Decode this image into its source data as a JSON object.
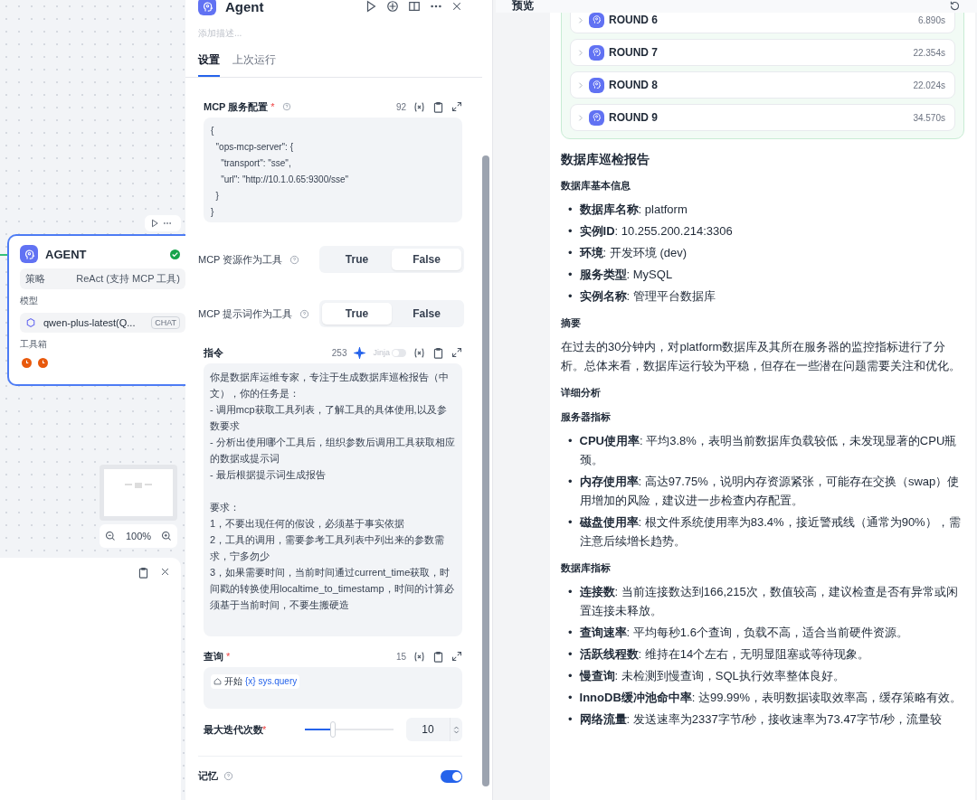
{
  "canvas": {
    "node": {
      "title": "AGENT",
      "strategy_label": "策略",
      "strategy_value": "ReAct (支持 MCP 工具)",
      "model_label": "模型",
      "model_name": "qwen-plus-latest(Q...",
      "model_tag": "CHAT",
      "tools_label": "工具箱",
      "tools": [
        {
          "color": "#e8590c"
        },
        {
          "color": "#e8590c"
        }
      ]
    },
    "zoom": "100%"
  },
  "panel": {
    "title": "Agent",
    "description_placeholder": "添加描述...",
    "tabs": [
      {
        "label": "设置",
        "selected": true
      },
      {
        "label": "上次运行",
        "selected": false
      }
    ],
    "mcp_config": {
      "label": "MCP 服务配置",
      "required_mark": "*",
      "count": "92",
      "value": "{\n  \"ops-mcp-server\": {\n    \"transport\": \"sse\",\n    \"url\": \"http://10.1.0.65:9300/sse\"\n  }\n}"
    },
    "switches": [
      {
        "label": "MCP 资源作为工具",
        "options": [
          {
            "label": "True",
            "selected": false
          },
          {
            "label": "False",
            "selected": true
          }
        ]
      },
      {
        "label": "MCP 提示词作为工具",
        "options": [
          {
            "label": "True",
            "selected": true
          },
          {
            "label": "False",
            "selected": false
          }
        ]
      }
    ],
    "instruction": {
      "label": "指令",
      "count": "253",
      "jinja_label": "Jinja",
      "jinja_on": false,
      "paragraphs": [
        [
          "你是数据库运维专家，专注于生成数据库巡检报告（中文），你的任务是：",
          "- 调用mcp获取工具列表，了解工具的具体使用,以及参数要求",
          "- 分析出使用哪个工具后，组织参数后调用工具获取相应的数据或提示词",
          "- 最后根据提示词生成报告"
        ],
        [
          "要求：",
          "1，不要出现任何的假设，必须基于事实依据",
          "2，工具的调用，需要参考工具列表中列出来的参数需求，宁多勿少",
          "3，如果需要时间，当前时间通过current_time获取，时间戳的转换使用localtime_to_timestamp，时间的计算必须基于当前时间，不要生搬硬造"
        ]
      ]
    },
    "query": {
      "label": "查询",
      "required_mark": "*",
      "count": "15",
      "source": "开始",
      "variable": "{x} sys.query"
    },
    "iterations": {
      "label": "最大迭代次数",
      "required_mark": "*",
      "level": 0.32,
      "value": "10"
    },
    "memory": {
      "label": "记忆",
      "on": true
    }
  },
  "preview": {
    "title": "预览",
    "rounds": [
      {
        "name": "ROUND 6",
        "time": "6.890s"
      },
      {
        "name": "ROUND 7",
        "time": "22.354s"
      },
      {
        "name": "ROUND 8",
        "time": "22.024s"
      },
      {
        "name": "ROUND 9",
        "time": "34.570s"
      }
    ],
    "report": [
      {
        "kind": "title",
        "text": "数据库巡检报告"
      },
      {
        "kind": "heading",
        "text": "数据库基本信息"
      },
      {
        "kind": "list",
        "marker": "•",
        "items": [
          "**数据库名称**: platform",
          "**实例ID**: 10.255.200.214:3306",
          "**环境**: 开发环境 (dev)",
          "**服务类型**: MySQL",
          "**实例名称**: 管理平台数据库"
        ]
      },
      {
        "kind": "heading",
        "text": "摘要"
      },
      {
        "kind": "paragraph",
        "text": "在过去的30分钟内，对platform数据库及其所在服务器的监控指标进行了分析。总体来看，数据库运行较为平稳，但存在一些潜在问题需要关注和优化。"
      },
      {
        "kind": "heading",
        "text": "详细分析"
      },
      {
        "kind": "heading",
        "text": "服务器指标"
      },
      {
        "kind": "list",
        "marker": "•",
        "items": [
          "**CPU使用率**: 平均3.8%，表明当前数据库负载较低，未发现显著的CPU瓶颈。",
          "**内存使用率**: 高达97.75%，说明内存资源紧张，可能存在交换（swap）使用增加的风险，建议进一步检查内存配置。",
          "**磁盘使用率**: 根文件系统使用率为83.4%，接近警戒线（通常为90%），需注意后续增长趋势。"
        ]
      },
      {
        "kind": "heading",
        "text": "数据库指标"
      },
      {
        "kind": "list",
        "marker": "•",
        "items": [
          "**连接数**: 当前连接数达到166,215次，数值较高，建议检查是否有异常或闲置连接未释放。",
          "**查询速率**: 平均每秒1.6个查询，负载不高，适合当前硬件资源。",
          "**活跃线程数**: 维持在14个左右，无明显阻塞或等待现象。",
          "**慢查询**: 未检测到慢查询，SQL执行效率整体良好。",
          "**InnoDB缓冲池命中率**: 达99.99%，表明数据读取效率高，缓存策略有效。",
          "**网络流量**: 发送速率为2337字节/秒，接收速率为73.47字节/秒，流量较"
        ]
      }
    ]
  }
}
